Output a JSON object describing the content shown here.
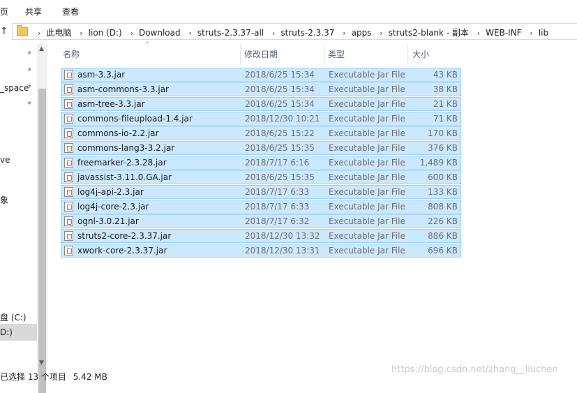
{
  "ribbon": {
    "tabs": [
      "页",
      "共享",
      "查看"
    ]
  },
  "address": {
    "crumbs": [
      "此电脑",
      "lion (D:)",
      "Download",
      "struts-2.3.37-all",
      "struts-2.3.37",
      "apps",
      "struts2-blank - 副本",
      "WEB-INF",
      "lib"
    ]
  },
  "nav": {
    "items": [
      "_space",
      "ve",
      "象",
      "盘 (C:)",
      "D:)"
    ]
  },
  "columns": {
    "name": "名称",
    "date": "修改日期",
    "type": "类型",
    "size": "大小"
  },
  "files": [
    {
      "name": "asm-3.3.jar",
      "date": "2018/6/25 15:34",
      "type": "Executable Jar File",
      "size": "43 KB"
    },
    {
      "name": "asm-commons-3.3.jar",
      "date": "2018/6/25 15:34",
      "type": "Executable Jar File",
      "size": "38 KB"
    },
    {
      "name": "asm-tree-3.3.jar",
      "date": "2018/6/25 15:34",
      "type": "Executable Jar File",
      "size": "21 KB"
    },
    {
      "name": "commons-fileupload-1.4.jar",
      "date": "2018/12/30 10:21",
      "type": "Executable Jar File",
      "size": "71 KB"
    },
    {
      "name": "commons-io-2.2.jar",
      "date": "2018/6/25 15:22",
      "type": "Executable Jar File",
      "size": "170 KB"
    },
    {
      "name": "commons-lang3-3.2.jar",
      "date": "2018/6/25 15:35",
      "type": "Executable Jar File",
      "size": "376 KB"
    },
    {
      "name": "freemarker-2.3.28.jar",
      "date": "2018/7/17 6:16",
      "type": "Executable Jar File",
      "size": "1,489 KB"
    },
    {
      "name": "javassist-3.11.0.GA.jar",
      "date": "2018/6/25 15:35",
      "type": "Executable Jar File",
      "size": "600 KB"
    },
    {
      "name": "log4j-api-2.3.jar",
      "date": "2018/7/17 6:33",
      "type": "Executable Jar File",
      "size": "133 KB"
    },
    {
      "name": "log4j-core-2.3.jar",
      "date": "2018/7/17 6:33",
      "type": "Executable Jar File",
      "size": "808 KB"
    },
    {
      "name": "ognl-3.0.21.jar",
      "date": "2018/7/17 6:32",
      "type": "Executable Jar File",
      "size": "226 KB"
    },
    {
      "name": "struts2-core-2.3.37.jar",
      "date": "2018/12/30 13:32",
      "type": "Executable Jar File",
      "size": "886 KB"
    },
    {
      "name": "xwork-core-2.3.37.jar",
      "date": "2018/12/30 13:31",
      "type": "Executable Jar File",
      "size": "696 KB"
    }
  ],
  "status": {
    "selected": "已选择 13 个项目",
    "size": "5.42 MB"
  },
  "watermark": "https://blog.csdn.net/zhang__liuchen",
  "colors": {
    "selection": "#cce8ff",
    "selection_border": "#99d1ff",
    "header_text": "#4d6082"
  },
  "icons": {
    "file": "jar-file-icon",
    "folder": "folder-icon",
    "pin": "pin-icon"
  }
}
